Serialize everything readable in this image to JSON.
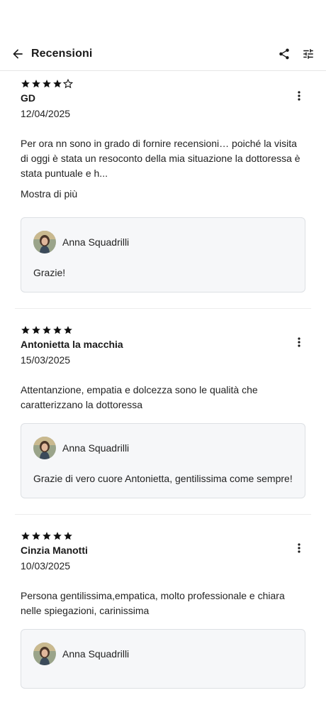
{
  "header": {
    "title": "Recensioni"
  },
  "reviews": [
    {
      "rating": 4,
      "reviewer": "GD",
      "date": "12/04/2025",
      "text": "Per ora nn sono in grado di fornire recensioni… poiché la visita di oggi è stata un resoconto della mia situazione  la dottoressa è stata puntuale e h...",
      "show_more": "Mostra di più",
      "reply": {
        "author": "Anna Squadrilli",
        "text": "Grazie!"
      }
    },
    {
      "rating": 5,
      "reviewer": "Antonietta la macchia",
      "date": "15/03/2025",
      "text": "Attentanzione, empatia e dolcezza sono le qualità che caratterizzano la dottoressa",
      "reply": {
        "author": "Anna Squadrilli",
        "text": "Grazie di vero cuore Antonietta, gentilissima come sempre!"
      }
    },
    {
      "rating": 5,
      "reviewer": "Cinzia Manotti",
      "date": "10/03/2025",
      "text": "Persona gentilissima,empatica, molto professionale e chiara nelle spiegazioni, carinissima",
      "reply": {
        "author": "Anna Squadrilli",
        "text": ""
      }
    }
  ],
  "colors": {
    "star": "#111111",
    "reply_bg": "#f6f7f9",
    "reply_border": "#dde0e4"
  }
}
